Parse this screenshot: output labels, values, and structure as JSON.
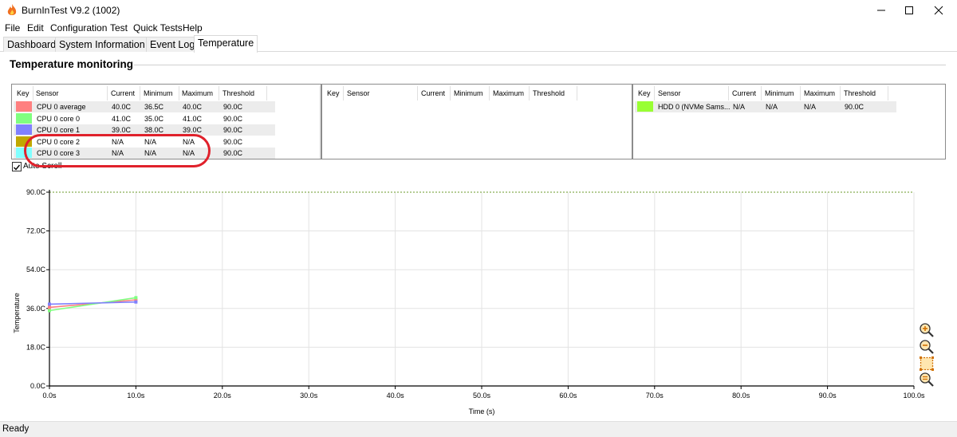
{
  "window": {
    "title": "BurnInTest V9.2 (1002)"
  },
  "menu": [
    "File",
    "Edit",
    "Configuration",
    "Test",
    "Quick Tests",
    "Help"
  ],
  "tabs": [
    "Dashboard",
    "System Information",
    "Event Log",
    "Temperature"
  ],
  "active_tab": "Temperature",
  "section": {
    "title": "Temperature monitoring"
  },
  "grid": {
    "headers": {
      "key": "Key",
      "sensor": "Sensor",
      "current": "Current",
      "minimum": "Minimum",
      "maximum": "Maximum",
      "threshold": "Threshold"
    },
    "panel1_rows": [
      {
        "color": "#ff8080",
        "sensor": "CPU 0 average",
        "current": "40.0C",
        "minimum": "36.5C",
        "maximum": "40.0C",
        "threshold": "90.0C"
      },
      {
        "color": "#80ff80",
        "sensor": "CPU 0 core 0",
        "current": "41.0C",
        "minimum": "35.0C",
        "maximum": "41.0C",
        "threshold": "90.0C"
      },
      {
        "color": "#8080ff",
        "sensor": "CPU 0 core 1",
        "current": "39.0C",
        "minimum": "38.0C",
        "maximum": "39.0C",
        "threshold": "90.0C"
      },
      {
        "color": "#c0a800",
        "sensor": "CPU 0 core 2",
        "current": "N/A",
        "minimum": "N/A",
        "maximum": "N/A",
        "threshold": "90.0C"
      },
      {
        "color": "#80ffff",
        "sensor": "CPU 0 core 3",
        "current": "N/A",
        "minimum": "N/A",
        "maximum": "N/A",
        "threshold": "90.0C"
      }
    ],
    "panel3_rows": [
      {
        "color": "#99ff33",
        "sensor": "HDD 0 (NVMe Sams...",
        "current": "N/A",
        "minimum": "N/A",
        "maximum": "N/A",
        "threshold": "90.0C"
      }
    ]
  },
  "autoscroll": {
    "label": "Auto Scroll",
    "checked": true
  },
  "status": {
    "text": "Ready"
  },
  "chart_data": {
    "type": "line",
    "xlabel": "Time (s)",
    "ylabel": "Temperature",
    "xlim": [
      0,
      100
    ],
    "ylim": [
      0,
      90
    ],
    "xticks": [
      "0.0s",
      "10.0s",
      "20.0s",
      "30.0s",
      "40.0s",
      "50.0s",
      "60.0s",
      "70.0s",
      "80.0s",
      "90.0s",
      "100.0s"
    ],
    "yticks": [
      "0.0C",
      "18.0C",
      "36.0C",
      "54.0C",
      "72.0C",
      "90.0C"
    ],
    "threshold": 90,
    "grid": true,
    "series": [
      {
        "name": "CPU 0 average",
        "color": "#ff8080",
        "x": [
          0,
          10
        ],
        "y": [
          36.5,
          40.0
        ]
      },
      {
        "name": "CPU 0 core 0",
        "color": "#80ff80",
        "x": [
          0,
          10
        ],
        "y": [
          35.0,
          41.0
        ]
      },
      {
        "name": "CPU 0 core 1",
        "color": "#8080ff",
        "x": [
          0,
          10
        ],
        "y": [
          38.0,
          39.0
        ]
      }
    ]
  }
}
